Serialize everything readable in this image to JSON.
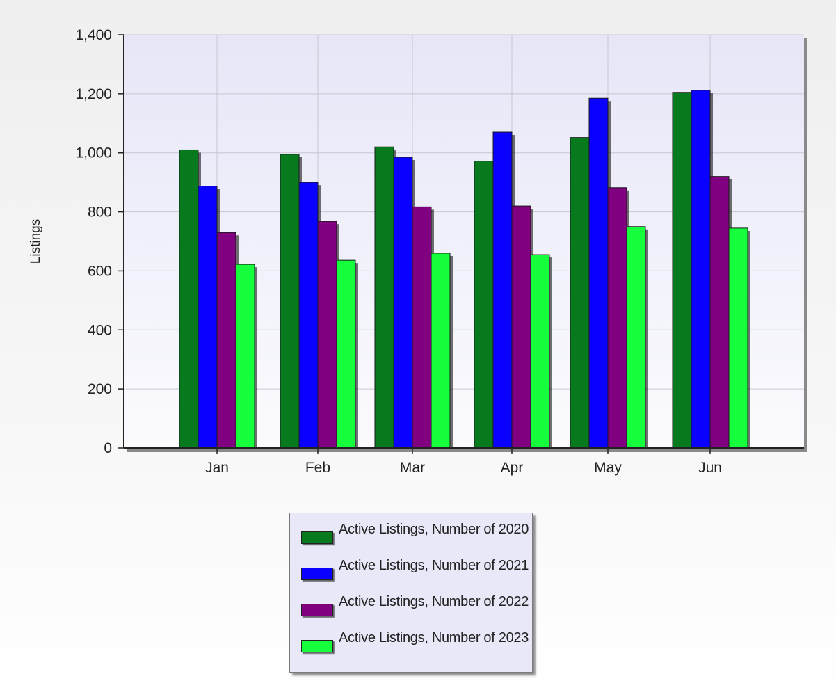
{
  "chart_data": {
    "type": "bar",
    "title": "",
    "xlabel": "",
    "ylabel": "Listings",
    "categories": [
      "Jan",
      "Feb",
      "Mar",
      "Apr",
      "May",
      "Jun"
    ],
    "ylim": [
      0,
      1400
    ],
    "yticks": [
      0,
      200,
      400,
      600,
      800,
      1000,
      1200,
      1400
    ],
    "ytick_labels": [
      "0",
      "200",
      "400",
      "600",
      "800",
      "1,000",
      "1,200",
      "1,400"
    ],
    "grid": true,
    "legend_position": "bottom",
    "series": [
      {
        "name": "Active Listings, Number of 2020",
        "color": "#087a1e",
        "values": [
          1010,
          995,
          1020,
          972,
          1052,
          1205
        ]
      },
      {
        "name": "Active Listings, Number of 2021",
        "color": "#0a00ff",
        "values": [
          887,
          900,
          985,
          1070,
          1185,
          1212
        ]
      },
      {
        "name": "Active Listings, Number of 2022",
        "color": "#800080",
        "values": [
          730,
          768,
          817,
          820,
          882,
          920
        ]
      },
      {
        "name": "Active Listings, Number of 2023",
        "color": "#16ff3c",
        "values": [
          622,
          636,
          660,
          655,
          750,
          745
        ]
      }
    ]
  }
}
